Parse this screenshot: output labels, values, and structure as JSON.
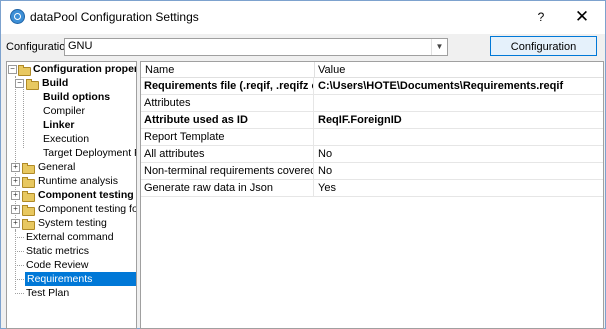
{
  "window": {
    "title": "dataPool Configuration Settings",
    "help_glyph": "?",
    "close_glyph": "✕"
  },
  "config": {
    "label": "Configuration:",
    "value": "GNU",
    "arrow": "▼",
    "manager_button": "Configuration Manager..."
  },
  "tree": {
    "root": "Configuration properties",
    "build": "Build",
    "build_options": "Build options",
    "compiler": "Compiler",
    "linker": "Linker",
    "execution": "Execution",
    "target_deployment": "Target Deployment Port",
    "general": "General",
    "runtime_analysis": "Runtime analysis",
    "component_testing_for": "Component testing for",
    "component_testing_c": "Component testing for C",
    "system_testing": "System testing",
    "external_command": "External command",
    "static_metrics": "Static metrics",
    "code_review": "Code Review",
    "requirements": "Requirements",
    "test_plan": "Test Plan",
    "expand_minus": "−",
    "expand_plus": "+"
  },
  "grid": {
    "col_name": "Name",
    "col_value": "Value",
    "rows": [
      {
        "name": "Requirements file (.reqif, .reqifz or",
        "value": "C:\\Users\\HOTE\\Documents\\Requirements.reqif"
      },
      {
        "name": "Attributes",
        "value": ""
      },
      {
        "name": "Attribute used as ID",
        "value": "ReqIF.ForeignID"
      },
      {
        "name": "Report Template",
        "value": ""
      },
      {
        "name": "All attributes",
        "value": "No"
      },
      {
        "name": "Non-terminal requirements covered by chil",
        "value": "No"
      },
      {
        "name": "Generate raw data in Json",
        "value": "Yes"
      }
    ]
  }
}
